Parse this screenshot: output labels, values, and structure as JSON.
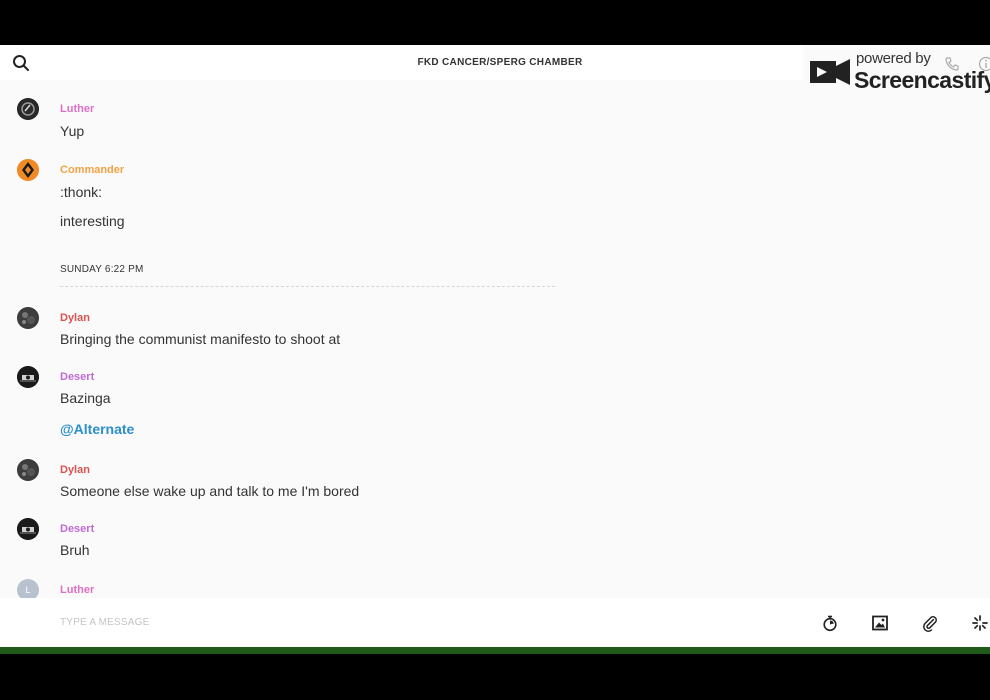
{
  "header": {
    "title": "FKD CANCER/SPERG CHAMBER"
  },
  "watermark": {
    "line1": "powered by",
    "line2": "Screencastify"
  },
  "messages": [
    {
      "author": "Luther",
      "color": "#dd6fc4",
      "lines": [
        "Yup"
      ]
    },
    {
      "author": "Commander",
      "color": "#f4a244",
      "lines": [
        ":thonk:",
        "interesting"
      ]
    },
    {
      "author": "Dylan",
      "color": "#d9534f",
      "lines": [
        "Bringing the communist manifesto to shoot at"
      ]
    },
    {
      "author": "Desert",
      "color": "#c46ad7",
      "lines": [
        "Bazinga"
      ],
      "mention": "@Alternate"
    },
    {
      "author": "Dylan",
      "color": "#d9534f",
      "lines": [
        "Someone else wake up and talk to me I'm bored"
      ]
    },
    {
      "author": "Desert",
      "color": "#c46ad7",
      "lines": [
        "Bruh"
      ]
    },
    {
      "author": "Luther",
      "color": "#dd6fc4",
      "lines": [],
      "avatar_initial": "L"
    }
  ],
  "divider": {
    "label": "SUNDAY 6:22 PM"
  },
  "composer": {
    "placeholder": "TYPE A MESSAGE"
  },
  "icons": {
    "search": "search-icon",
    "call": "phone-icon",
    "info": "info-icon",
    "timer": "stopwatch-icon",
    "image": "image-icon",
    "attach": "paperclip-icon",
    "more": "sparkle-icon"
  }
}
